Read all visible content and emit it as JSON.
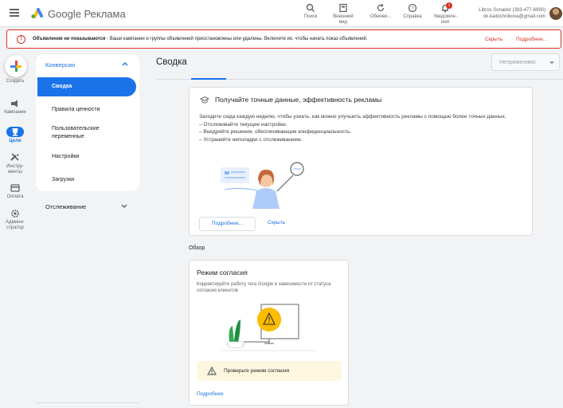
{
  "header": {
    "brand": "Google Реклама",
    "items": [
      {
        "label": "Поиск",
        "icon": "search-icon"
      },
      {
        "label": "Внешний вид",
        "icon": "appearance-icon"
      },
      {
        "label": "Обнови...",
        "icon": "refresh-icon"
      },
      {
        "label": "Справка",
        "icon": "help-icon"
      },
      {
        "label": "Уведомле-ния",
        "icon": "bell-icon",
        "badge": "1"
      }
    ],
    "account_name": "Libros Sonador (393-477-6990)",
    "account_email": "ok.kadochnikova@gmail.com"
  },
  "alert": {
    "title": "Объявления не показываются",
    "text": " - Ваши кампании и группы объявлений приостановлены или удалены. Включите их, чтобы начать показ объявлений.",
    "hide": "Скрыть",
    "more": "Подробнее..."
  },
  "leftnav": {
    "create": "Создать",
    "campaigns": "Кампании",
    "goals": "Цели",
    "tools": "Инстру-менты",
    "billing": "Оплата",
    "admin": "Админи-стратор"
  },
  "subnav": {
    "section": "Конверсии",
    "items": [
      "Сводка",
      "Правила ценности",
      "Пользовательские переменные",
      "Настройки",
      "Загрузки"
    ],
    "tracking": "Отслеживание"
  },
  "main": {
    "title": "Сводка",
    "select_value": "Неприменимо",
    "promo": {
      "title": "Получайте точные данные, эффективность рекламы",
      "body_1": "Заходите сюда каждую неделю, чтобы узнать, как можно улучшить эффективность рекламы с помощью более точных данных.",
      "body_2": "– Отслеживайте текущие настройки.",
      "body_3": "– Внедряйте решения, обеспечивающие конфиденциальность.",
      "body_4": "– Устраняйте неполадки с отслеживанием.",
      "more": "Подробнее...",
      "hide": "Скрыть"
    },
    "overview": "Обзор",
    "consent": {
      "title": "Режим согласия",
      "desc": "Корректируйте работу тега Google в зависимости от статуса согласия клиентов",
      "warning": "Проверьте режим согласия",
      "link": "Подробнее"
    }
  },
  "colors": {
    "accent": "#1a73e8",
    "error": "#d93025",
    "warning": "#fbbc04"
  }
}
